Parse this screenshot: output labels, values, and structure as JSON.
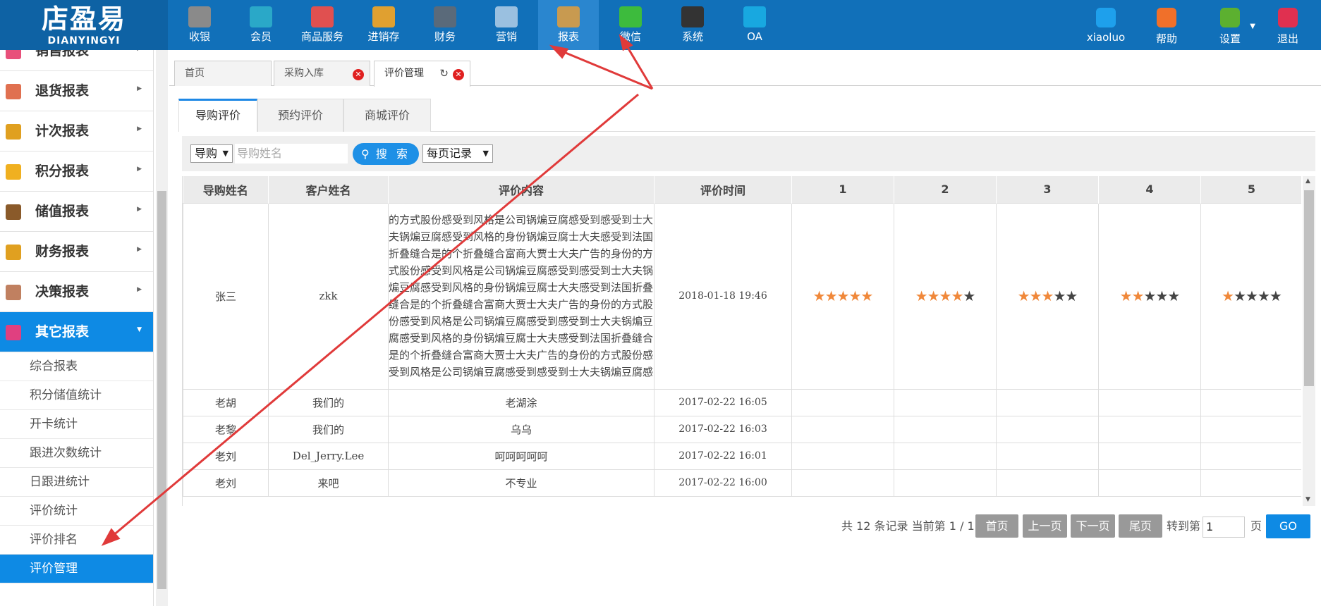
{
  "brand": {
    "name_cn": "店盈易",
    "name_en": "DIANYINGYI"
  },
  "topnav": [
    {
      "label": "收银",
      "icon": "register-icon",
      "color": "#8a8a8a"
    },
    {
      "label": "会员",
      "icon": "member-icon",
      "color": "#2aa8c8"
    },
    {
      "label": "商品服务",
      "icon": "goods-icon",
      "color": "#e05050"
    },
    {
      "label": "进销存",
      "icon": "inventory-icon",
      "color": "#e0a030"
    },
    {
      "label": "财务",
      "icon": "finance-icon",
      "color": "#5a6a7a"
    },
    {
      "label": "营销",
      "icon": "megaphone-icon",
      "color": "#9ac0e0"
    },
    {
      "label": "报表",
      "icon": "report-icon",
      "color": "#c89a50"
    },
    {
      "label": "微信",
      "icon": "wechat-icon",
      "color": "#3dbb3d"
    },
    {
      "label": "系统",
      "icon": "monitor-icon",
      "color": "#333333"
    },
    {
      "label": "OA",
      "icon": "oa-icon",
      "color": "#18a8e0"
    }
  ],
  "rightnav": [
    {
      "label": "xiaoluo",
      "icon": "user-icon",
      "color": "#1ea0ec"
    },
    {
      "label": "帮助",
      "icon": "help-icon",
      "color": "#f0702a"
    },
    {
      "label": "设置",
      "icon": "gear-icon",
      "color": "#5cb030"
    },
    {
      "label": "退出",
      "icon": "logout-icon",
      "color": "#e03050"
    }
  ],
  "sidebar": {
    "items": [
      {
        "label": "销售报表",
        "icon": "sales-report-icon",
        "color": "#e8507a"
      },
      {
        "label": "退货报表",
        "icon": "return-report-icon",
        "color": "#e07050"
      },
      {
        "label": "计次报表",
        "icon": "bar-chart-icon",
        "color": "#e0a020"
      },
      {
        "label": "积分报表",
        "icon": "tag-icon",
        "color": "#f0b020"
      },
      {
        "label": "储值报表",
        "icon": "wallet-icon",
        "color": "#8a5a2a"
      },
      {
        "label": "财务报表",
        "icon": "coin-icon",
        "color": "#e0a020"
      },
      {
        "label": "决策报表",
        "icon": "thumb-icon",
        "color": "#c08060"
      },
      {
        "label": "其它报表",
        "icon": "folder-icon",
        "color": "#e04080"
      }
    ],
    "subitems": [
      "综合报表",
      "积分储值统计",
      "开卡统计",
      "跟进次数统计",
      "日跟进统计",
      "评价统计",
      "评价排名",
      "评价管理"
    ]
  },
  "tabs": [
    {
      "label": "首页"
    },
    {
      "label": "采购入库"
    },
    {
      "label": "评价管理"
    }
  ],
  "subtabs": [
    "导购评价",
    "预约评价",
    "商城评价"
  ],
  "search": {
    "type_value": "导购",
    "name_placeholder": "导购姓名",
    "button_label": "搜 索",
    "pagesize_value": "每页记录"
  },
  "table": {
    "headers": [
      "导购姓名",
      "客户姓名",
      "评价内容",
      "评价时间",
      "1",
      "2",
      "3",
      "4",
      "5"
    ],
    "rows": [
      {
        "guide": "张三",
        "customer": "zkk",
        "content": "的方式股份感受到风格是公司锅煸豆腐感受到感受到士大夫锅煸豆腐感受到风格的身份锅煸豆腐士大夫感受到法国折叠缝合是的个折叠缝合富商大贾士大夫广告的身份的方式股份感受到风格是公司锅煸豆腐感受到感受到士大夫锅煸豆腐感受到风格的身份锅煸豆腐士大夫感受到法国折叠缝合是的个折叠缝合富商大贾士大夫广告的身份的方式股份感受到风格是公司锅煸豆腐感受到感受到士大夫锅煸豆腐感受到风格的身份锅煸豆腐士大夫感受到法国折叠缝合是的个折叠缝合富商大贾士大夫广告的身份的方式股份感受到风格是公司锅煸豆腐感受到感受到士大夫锅煸豆腐感",
        "time": "2018-01-18 19:46",
        "ratings": [
          5,
          4,
          3,
          2,
          1
        ]
      },
      {
        "guide": "老胡",
        "customer": "我们的",
        "content": "老湖涂",
        "time": "2017-02-22 16:05",
        "ratings": [
          0,
          0,
          0,
          0,
          0
        ]
      },
      {
        "guide": "老黎",
        "customer": "我们的",
        "content": "乌乌",
        "time": "2017-02-22 16:03",
        "ratings": [
          0,
          0,
          0,
          0,
          0
        ]
      },
      {
        "guide": "老刘",
        "customer": "Del_Jerry.Lee",
        "content": "呵呵呵呵呵",
        "time": "2017-02-22 16:01",
        "ratings": [
          0,
          0,
          0,
          0,
          0
        ]
      },
      {
        "guide": "老刘",
        "customer": "来吧",
        "content": "不专业",
        "time": "2017-02-22 16:00",
        "ratings": [
          0,
          0,
          0,
          0,
          0
        ]
      }
    ]
  },
  "pager": {
    "summary": "共 12 条记录 当前第 1 / 1",
    "first": "首页",
    "prev": "上一页",
    "next": "下一页",
    "last": "尾页",
    "goto_label": "转到第",
    "page_value": "1",
    "page_suffix": "页",
    "go": "GO"
  },
  "colors": {
    "brand": "#1170b9",
    "accent": "#0e8ae4",
    "annotation": "#e03a3a",
    "star": "#f0883a"
  }
}
